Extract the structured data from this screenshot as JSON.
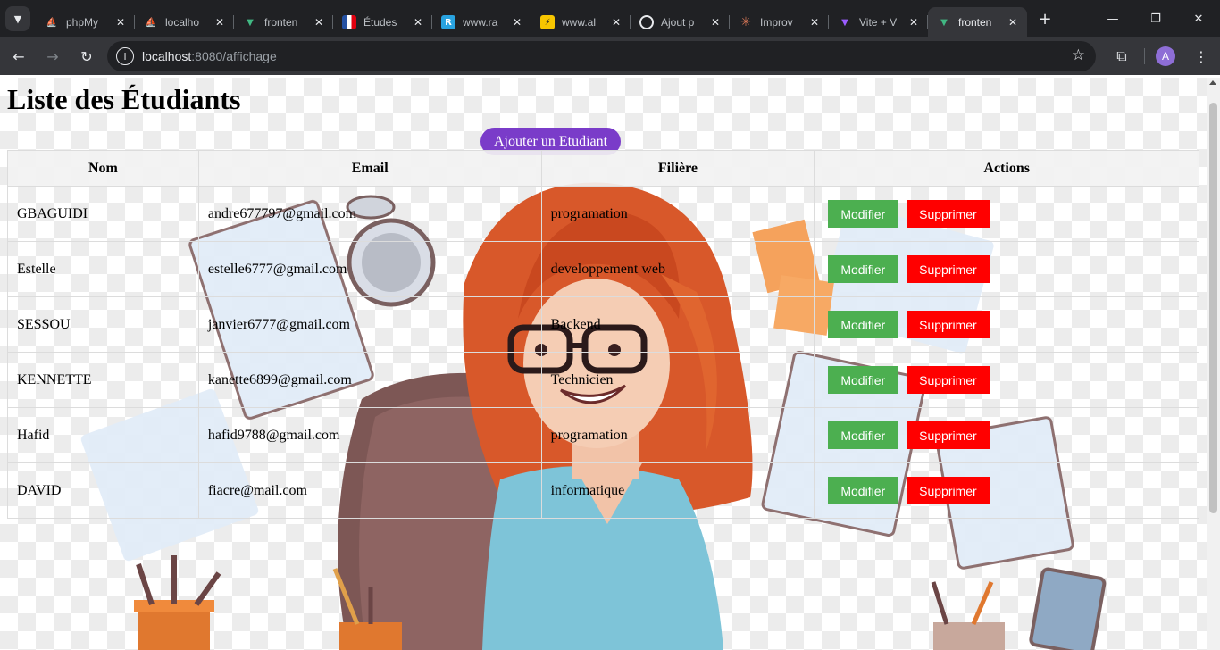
{
  "browser": {
    "tabs": [
      {
        "title": "phpMy",
        "favicon": "phpmyadmin-icon",
        "color": "#f29111"
      },
      {
        "title": "localho",
        "favicon": "phpmyadmin-icon",
        "color": "#f29111"
      },
      {
        "title": "fronten",
        "favicon": "vue-icon",
        "color": "#41b883"
      },
      {
        "title": "Études",
        "favicon": "flag-icon",
        "color": "#2451a3"
      },
      {
        "title": "www.ra",
        "favicon": "site-icon",
        "color": "#29a3e0"
      },
      {
        "title": "www.al",
        "favicon": "site-icon",
        "color": "#f7c600"
      },
      {
        "title": "Ajout p",
        "favicon": "chatgpt-icon",
        "color": "#e8eaed"
      },
      {
        "title": "Improv",
        "favicon": "claude-icon",
        "color": "#d97757"
      },
      {
        "title": "Vite + V",
        "favicon": "vite-icon",
        "color": "#9b5cff"
      },
      {
        "title": "fronten",
        "favicon": "vue-icon",
        "color": "#41b883"
      }
    ],
    "url_host": "localhost",
    "url_rest": ":8080/affichage",
    "avatar_letter": "A"
  },
  "page": {
    "title": "Liste des Étudiants",
    "add_button": "Ajouter un Etudiant",
    "columns": [
      "Nom",
      "Email",
      "Filière",
      "Actions"
    ],
    "rows": [
      {
        "nom": "GBAGUIDI",
        "email": "andre677797@gmail.com",
        "filiere": "programation"
      },
      {
        "nom": "Estelle",
        "email": "estelle6777@gmail.com",
        "filiere": "developpement web"
      },
      {
        "nom": "SESSOU",
        "email": "janvier6777@gmail.com",
        "filiere": "Backend"
      },
      {
        "nom": "KENNETTE",
        "email": "kanette6899@gmail.com",
        "filiere": "Technicien"
      },
      {
        "nom": "Hafid",
        "email": "hafid9788@gmail.com",
        "filiere": "programation"
      },
      {
        "nom": "DAVID",
        "email": "fiacre@mail.com",
        "filiere": "informatique"
      }
    ],
    "modify_label": "Modifier",
    "delete_label": "Supprimer",
    "colors": {
      "modify": "#4caf50",
      "delete": "#ff0000",
      "add": "#7a3cc9"
    }
  }
}
